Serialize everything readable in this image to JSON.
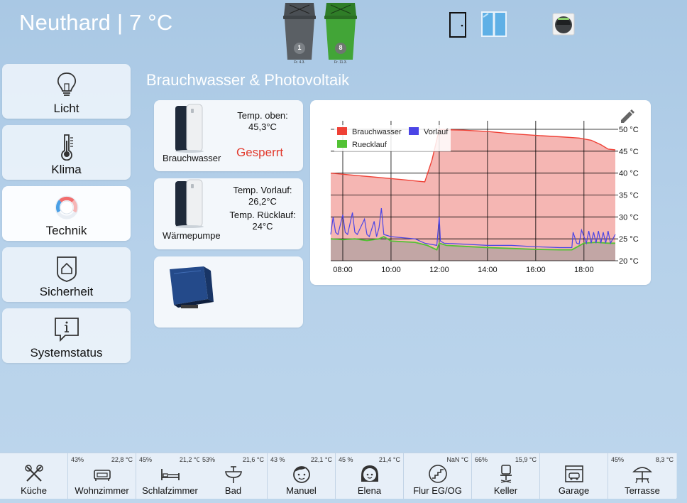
{
  "header": {
    "title": "Neuthard | 7 °C",
    "bins": [
      {
        "icon": "gray-trash-bin-icon",
        "count": "1",
        "date": "Fr. 4.3.",
        "color": "#555b60"
      },
      {
        "icon": "green-trash-bin-icon",
        "count": "8",
        "date": "Fr. 11.3.",
        "color": "#3fa534"
      }
    ],
    "icons": [
      "door-icon",
      "window-icon",
      "robot-vacuum-icon"
    ]
  },
  "nav": [
    {
      "label": "Licht",
      "icon": "lightbulb-icon"
    },
    {
      "label": "Klima",
      "icon": "thermometer-icon"
    },
    {
      "label": "Technik",
      "icon": "dial-icon",
      "active": true
    },
    {
      "label": "Sicherheit",
      "icon": "shield-home-icon"
    },
    {
      "label": "Systemstatus",
      "icon": "info-bubble-icon"
    }
  ],
  "section": {
    "title": "Brauchwasser & Photovoltaik"
  },
  "cards": {
    "brauchwasser": {
      "name": "Brauchwasser",
      "temp_label": "Temp. oben:",
      "temp_value": "45,3°C",
      "status": "Gesperrt"
    },
    "waermepumpe": {
      "name": "Wärmepumpe",
      "vorlauf_label": "Temp. Vorlauf:",
      "vorlauf_value": "26,2°C",
      "ruecklauf_label": "Temp. Rücklauf:",
      "ruecklauf_value": "24°C"
    },
    "inverter": {
      "icon": "solar-inverter-icon"
    }
  },
  "chart_data": {
    "type": "area",
    "edit_icon": "pencil-icon",
    "legend_position": "top-left",
    "grid": true,
    "xlim": [
      7.5,
      19.3
    ],
    "ylim": [
      20,
      50
    ],
    "x_ticks": [
      "08:00",
      "10:00",
      "12:00",
      "14:00",
      "16:00",
      "18:00"
    ],
    "y_ticks": [
      "20 °C",
      "25 °C",
      "30 °C",
      "35 °C",
      "40 °C",
      "45 °C",
      "50 °C"
    ],
    "series": [
      {
        "name": "Brauchwasser",
        "color": "#ef4136",
        "fill": "#f5b6b3",
        "x": [
          7.5,
          8.5,
          9.5,
          10.5,
          11.4,
          11.7,
          12.0,
          12.3,
          13.0,
          14.0,
          15.0,
          16.0,
          17.0,
          17.8,
          18.3,
          18.7,
          19.0,
          19.3
        ],
        "y": [
          40.0,
          39.5,
          39.0,
          38.5,
          38.0,
          43.0,
          50.0,
          49.9,
          49.8,
          49.5,
          49.0,
          48.6,
          48.3,
          48.0,
          47.5,
          46.5,
          45.5,
          45.3
        ]
      },
      {
        "name": "Vorlauf",
        "color": "#4b45e6",
        "x": [
          7.5,
          7.6,
          7.7,
          7.8,
          8.0,
          8.1,
          8.2,
          8.4,
          8.5,
          8.6,
          8.9,
          9.0,
          9.1,
          9.3,
          9.4,
          9.5,
          9.6,
          9.7,
          10.0,
          11.0,
          11.4,
          11.9,
          12.0,
          12.05,
          12.2,
          13.0,
          14.0,
          15.0,
          16.0,
          17.0,
          17.5,
          17.55,
          17.7,
          17.8,
          17.9,
          18.1,
          18.2,
          18.3,
          18.4,
          18.5,
          18.6,
          18.7,
          18.8,
          18.9,
          19.0,
          19.1,
          19.3
        ],
        "y": [
          26.0,
          30.0,
          26.5,
          26.0,
          30.5,
          26.5,
          26.0,
          31.0,
          26.5,
          26.0,
          29.5,
          26.0,
          25.5,
          29.0,
          25.5,
          27.5,
          32.0,
          26.0,
          25.5,
          25.0,
          24.0,
          23.5,
          30.0,
          24.5,
          24.0,
          23.8,
          23.5,
          23.5,
          23.2,
          23.0,
          23.0,
          26.5,
          24.0,
          23.8,
          27.0,
          24.0,
          26.8,
          24.0,
          26.5,
          24.0,
          26.8,
          24.0,
          26.5,
          24.0,
          26.8,
          24.0,
          26.0
        ]
      },
      {
        "name": "Ruecklauf",
        "color": "#52c234",
        "fill": "#c2a6a5",
        "x": [
          7.5,
          8.0,
          8.5,
          9.0,
          9.5,
          9.7,
          10.0,
          11.0,
          11.5,
          11.9,
          12.0,
          12.3,
          13.0,
          14.0,
          15.0,
          16.0,
          17.0,
          17.5,
          18.0,
          18.5,
          19.0,
          19.3
        ],
        "y": [
          25.0,
          24.8,
          25.0,
          24.6,
          25.0,
          25.5,
          24.5,
          24.2,
          23.5,
          22.5,
          24.0,
          23.5,
          23.3,
          23.0,
          22.8,
          22.6,
          22.5,
          22.5,
          24.0,
          24.2,
          24.0,
          24.0
        ]
      }
    ]
  },
  "rooms": [
    {
      "label": "Küche",
      "humidity": "",
      "temp": "",
      "icon": "kitchen-utensils-icon"
    },
    {
      "label": "Wohnzimmer",
      "humidity": "43%",
      "temp": "22,8 °C",
      "icon": "sofa-icon"
    },
    {
      "label": "Schlafzimmer",
      "humidity": "45%",
      "temp": "21,2 °C",
      "icon": "bed-icon"
    },
    {
      "label": "Bad",
      "humidity": "53%",
      "temp": "21,6 °C",
      "icon": "sink-icon"
    },
    {
      "label": "Manuel",
      "humidity": "43 %",
      "temp": "22,1 °C",
      "icon": "boy-face-icon"
    },
    {
      "label": "Elena",
      "humidity": "45 %",
      "temp": "21,4 °C",
      "icon": "girl-face-icon"
    },
    {
      "label": "Flur EG/OG",
      "humidity": "",
      "temp": "NaN °C",
      "icon": "stairs-icon"
    },
    {
      "label": "Keller",
      "humidity": "66%",
      "temp": "15,9 °C",
      "icon": "office-chair-icon"
    },
    {
      "label": "Garage",
      "humidity": "",
      "temp": "",
      "icon": "garage-icon"
    },
    {
      "label": "Terrasse",
      "humidity": "45%",
      "temp": "8,3 °C",
      "icon": "patio-umbrella-icon"
    }
  ]
}
